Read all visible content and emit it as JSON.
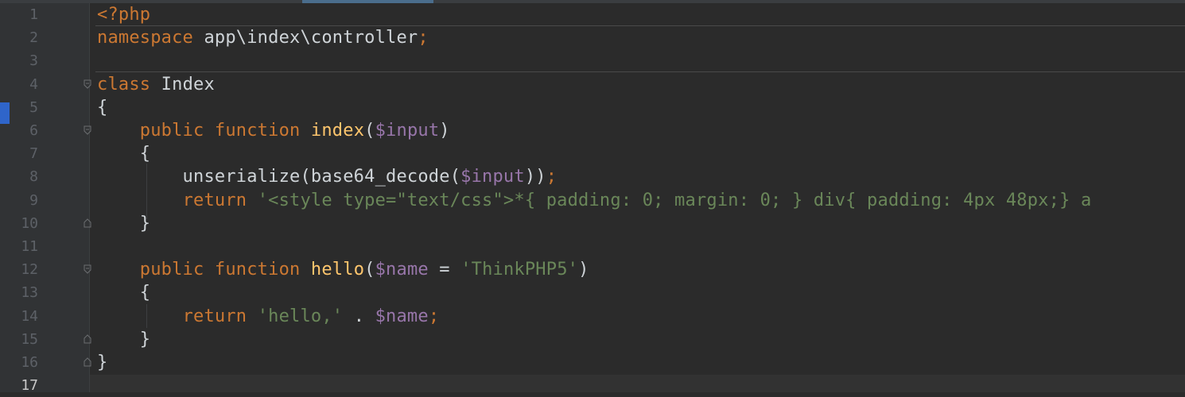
{
  "editor": {
    "lines": [
      {
        "num": "1",
        "segments": [
          {
            "t": "<?php",
            "c": "kw"
          }
        ]
      },
      {
        "num": "2",
        "segments": [
          {
            "t": "namespace",
            "c": "kw"
          },
          {
            "t": " app\\index\\controller",
            "c": "plain"
          },
          {
            "t": ";",
            "c": "kw"
          }
        ]
      },
      {
        "num": "3",
        "segments": []
      },
      {
        "num": "4",
        "segments": [
          {
            "t": "class",
            "c": "kw"
          },
          {
            "t": " Index",
            "c": "plain"
          }
        ]
      },
      {
        "num": "5",
        "segments": [
          {
            "t": "{",
            "c": "plain"
          }
        ]
      },
      {
        "num": "6",
        "segments": [
          {
            "t": "    ",
            "c": "plain"
          },
          {
            "t": "public function",
            "c": "kw"
          },
          {
            "t": " ",
            "c": "plain"
          },
          {
            "t": "index",
            "c": "fn"
          },
          {
            "t": "(",
            "c": "plain"
          },
          {
            "t": "$input",
            "c": "var"
          },
          {
            "t": ")",
            "c": "plain"
          }
        ]
      },
      {
        "num": "7",
        "segments": [
          {
            "t": "    {",
            "c": "plain"
          }
        ]
      },
      {
        "num": "8",
        "segments": [
          {
            "t": "        unserialize(base64_decode(",
            "c": "plain"
          },
          {
            "t": "$input",
            "c": "var"
          },
          {
            "t": "))",
            "c": "plain"
          },
          {
            "t": ";",
            "c": "kw"
          }
        ]
      },
      {
        "num": "9",
        "segments": [
          {
            "t": "        ",
            "c": "plain"
          },
          {
            "t": "return",
            "c": "kw"
          },
          {
            "t": " ",
            "c": "plain"
          },
          {
            "t": "'<style type=\"text/css\">*{ padding: 0; margin: 0; } div{ padding: 4px 48px;} a",
            "c": "str"
          }
        ]
      },
      {
        "num": "10",
        "segments": [
          {
            "t": "    }",
            "c": "plain"
          }
        ]
      },
      {
        "num": "11",
        "segments": []
      },
      {
        "num": "12",
        "segments": [
          {
            "t": "    ",
            "c": "plain"
          },
          {
            "t": "public function",
            "c": "kw"
          },
          {
            "t": " ",
            "c": "plain"
          },
          {
            "t": "hello",
            "c": "fn"
          },
          {
            "t": "(",
            "c": "plain"
          },
          {
            "t": "$name",
            "c": "var"
          },
          {
            "t": " = ",
            "c": "plain"
          },
          {
            "t": "'ThinkPHP5'",
            "c": "str"
          },
          {
            "t": ")",
            "c": "plain"
          }
        ]
      },
      {
        "num": "13",
        "segments": [
          {
            "t": "    {",
            "c": "plain"
          }
        ]
      },
      {
        "num": "14",
        "segments": [
          {
            "t": "        ",
            "c": "plain"
          },
          {
            "t": "return",
            "c": "kw"
          },
          {
            "t": " ",
            "c": "plain"
          },
          {
            "t": "'hello,'",
            "c": "str"
          },
          {
            "t": " . ",
            "c": "plain"
          },
          {
            "t": "$name",
            "c": "var"
          },
          {
            "t": ";",
            "c": "kw"
          }
        ]
      },
      {
        "num": "15",
        "segments": [
          {
            "t": "    }",
            "c": "plain"
          }
        ]
      },
      {
        "num": "16",
        "segments": [
          {
            "t": "}",
            "c": "plain"
          }
        ]
      },
      {
        "num": "17",
        "segments": []
      }
    ],
    "current_line": "17",
    "fold_markers": {
      "4": "open",
      "6": "open",
      "10": "close",
      "12": "open",
      "15": "close",
      "16": "close"
    }
  },
  "colors": {
    "keyword": "#cc7832",
    "function": "#ffc66d",
    "variable": "#9876aa",
    "string": "#6a8759",
    "text": "#cfd4d8",
    "background": "#2b2b2b"
  }
}
